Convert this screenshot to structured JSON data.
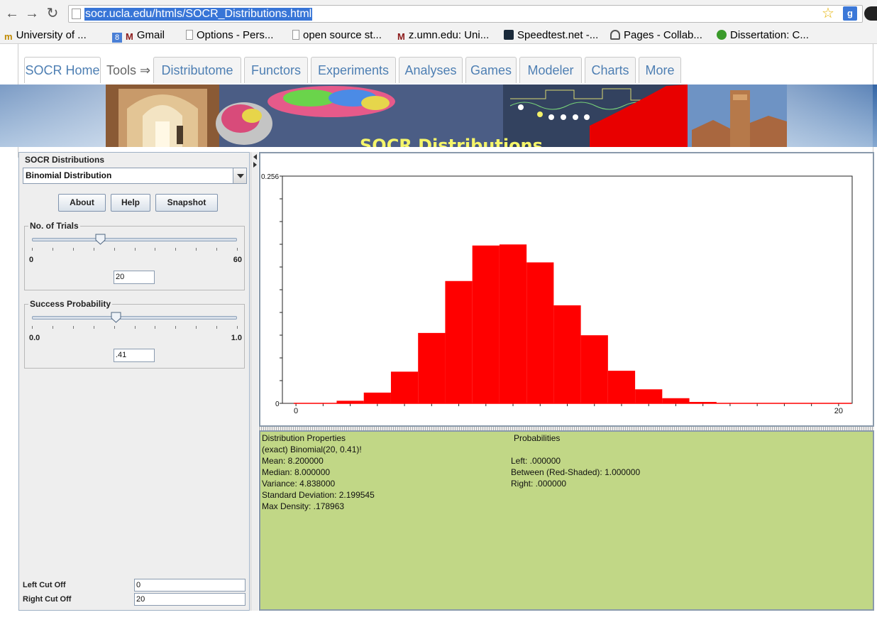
{
  "browser": {
    "url": "socr.ucla.edu/htmls/SOCR_Distributions.html",
    "bookmarks": [
      "University of ...",
      "Gmail",
      "Options - Pers...",
      "open source st...",
      "z.umn.edu: Uni...",
      "Speedtest.net -...",
      "Pages - Collab...",
      "Dissertation: C..."
    ]
  },
  "site": {
    "tabs": [
      "SOCR Home",
      "Distributome",
      "Functors",
      "Experiments",
      "Analyses",
      "Games",
      "Modeler",
      "Charts",
      "More"
    ],
    "tools_label": "Tools ⇒",
    "banner_title": "SOCR Distributions"
  },
  "panel": {
    "title": "SOCR Distributions",
    "distribution": "Binomial Distribution",
    "buttons": {
      "about": "About",
      "help": "Help",
      "snapshot": "Snapshot"
    },
    "trials": {
      "label": "No. of Trials",
      "min": "0",
      "max": "60",
      "value": "20",
      "slider_fraction": 0.3333
    },
    "probability": {
      "label": "Success Probability",
      "min": "0.0",
      "max": "1.0",
      "value": ".41",
      "slider_fraction": 0.41
    },
    "left_cutoff": {
      "label": "Left Cut Off",
      "value": "0"
    },
    "right_cutoff": {
      "label": "Right Cut Off",
      "value": "20"
    }
  },
  "chart_data": {
    "type": "bar",
    "x": [
      0,
      1,
      2,
      3,
      4,
      5,
      6,
      7,
      8,
      9,
      10,
      11,
      12,
      13,
      14,
      15,
      16,
      17,
      18,
      19,
      20
    ],
    "values": [
      3e-05,
      0.0004,
      0.0029,
      0.0121,
      0.0357,
      0.0793,
      0.1378,
      0.1778,
      0.179,
      0.1588,
      0.1104,
      0.0767,
      0.0367,
      0.0158,
      0.0058,
      0.0016,
      0.0004,
      8e-05,
      1e-05,
      0.0,
      0.0
    ],
    "ylim": [
      0,
      0.256
    ],
    "xlim": [
      -0.5,
      20.5
    ],
    "y_tick_labels": [
      "0.256",
      "0"
    ],
    "x_tick_labels": [
      "0",
      "20"
    ],
    "bar_color": "#ff0000"
  },
  "info": {
    "properties_header": "Distribution Properties",
    "properties": [
      "(exact) Binomial(20, 0.41)!",
      "Mean: 8.200000",
      "Median: 8.000000",
      "Variance: 4.838000",
      "Standard Deviation: 2.199545",
      "Max Density: .178963"
    ],
    "probabilities_header": "Probabilities",
    "probabilities": [
      "Left: .000000",
      "Between (Red-Shaded): 1.000000",
      "Right: .000000"
    ]
  }
}
